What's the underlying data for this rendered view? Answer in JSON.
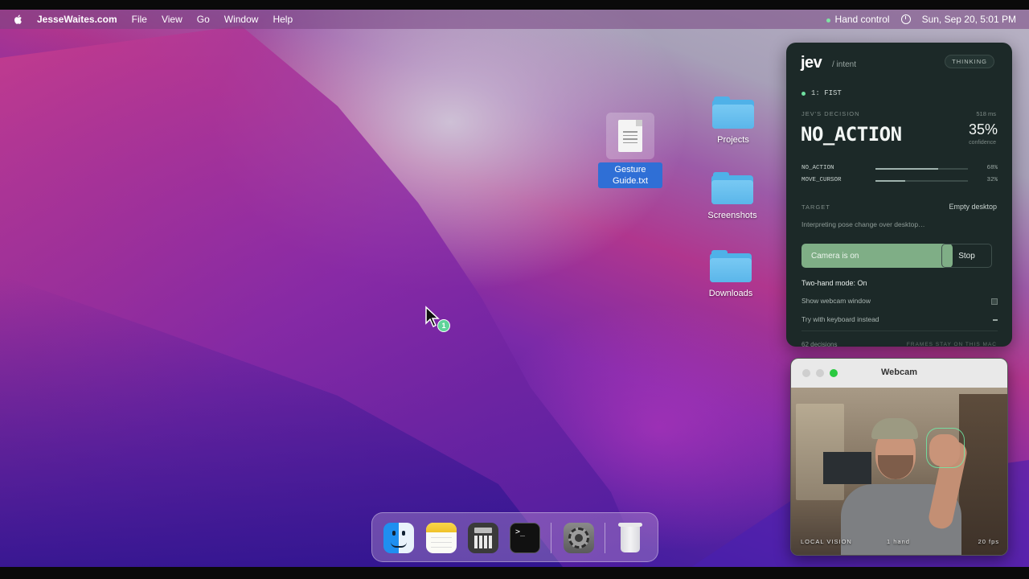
{
  "menubar": {
    "app_name": "JesseWaites.com",
    "menus": [
      "File",
      "View",
      "Go",
      "Window",
      "Help"
    ],
    "status_text": "Hand control",
    "datetime": "Sun, Sep 20, 5:01 PM"
  },
  "desktop": {
    "file": {
      "name": "Gesture Guide.txt"
    },
    "folders": [
      "Projects",
      "Screenshots",
      "Downloads"
    ],
    "cursor_badge": "1"
  },
  "panel": {
    "logo": "jev",
    "subtitle": "/ intent",
    "status_badge": "THINKING",
    "gesture": "1: FIST",
    "decision_section": "JEV'S DECISION",
    "latency": "518 ms",
    "decision": "NO_ACTION",
    "confidence_value": "35%",
    "confidence_label": "confidence",
    "candidates": [
      {
        "label": "NO_ACTION",
        "value": "68%",
        "fraction": 0.68
      },
      {
        "label": "MOVE_CURSOR",
        "value": "32%",
        "fraction": 0.32
      }
    ],
    "target_label": "TARGET",
    "target_value": "Empty desktop",
    "interpretation": "Interpreting pose change over desktop…",
    "camera_button": "Camera is on",
    "stop_button": "Stop",
    "two_hand_mode": "Two-hand mode: On",
    "option_webcam": "Show webcam window",
    "option_keyboard": "Try with keyboard instead",
    "decisions_count": "62 decisions",
    "footer": "FRAMES STAY ON THIS MAC"
  },
  "webcam": {
    "title": "Webcam",
    "hud_left": "LOCAL VISION",
    "hud_center": "1 hand",
    "hud_right": "20 fps"
  },
  "dock": {
    "apps": [
      "finder-icon",
      "notes-icon",
      "calculator-icon",
      "terminal-icon",
      "system-settings-icon",
      "trash-icon"
    ]
  },
  "colors": {
    "panel_bg": "#1c2928",
    "camera_button": "#7fae86",
    "status_dot": "#6fe0a0",
    "selection": "#2f6fd6"
  }
}
